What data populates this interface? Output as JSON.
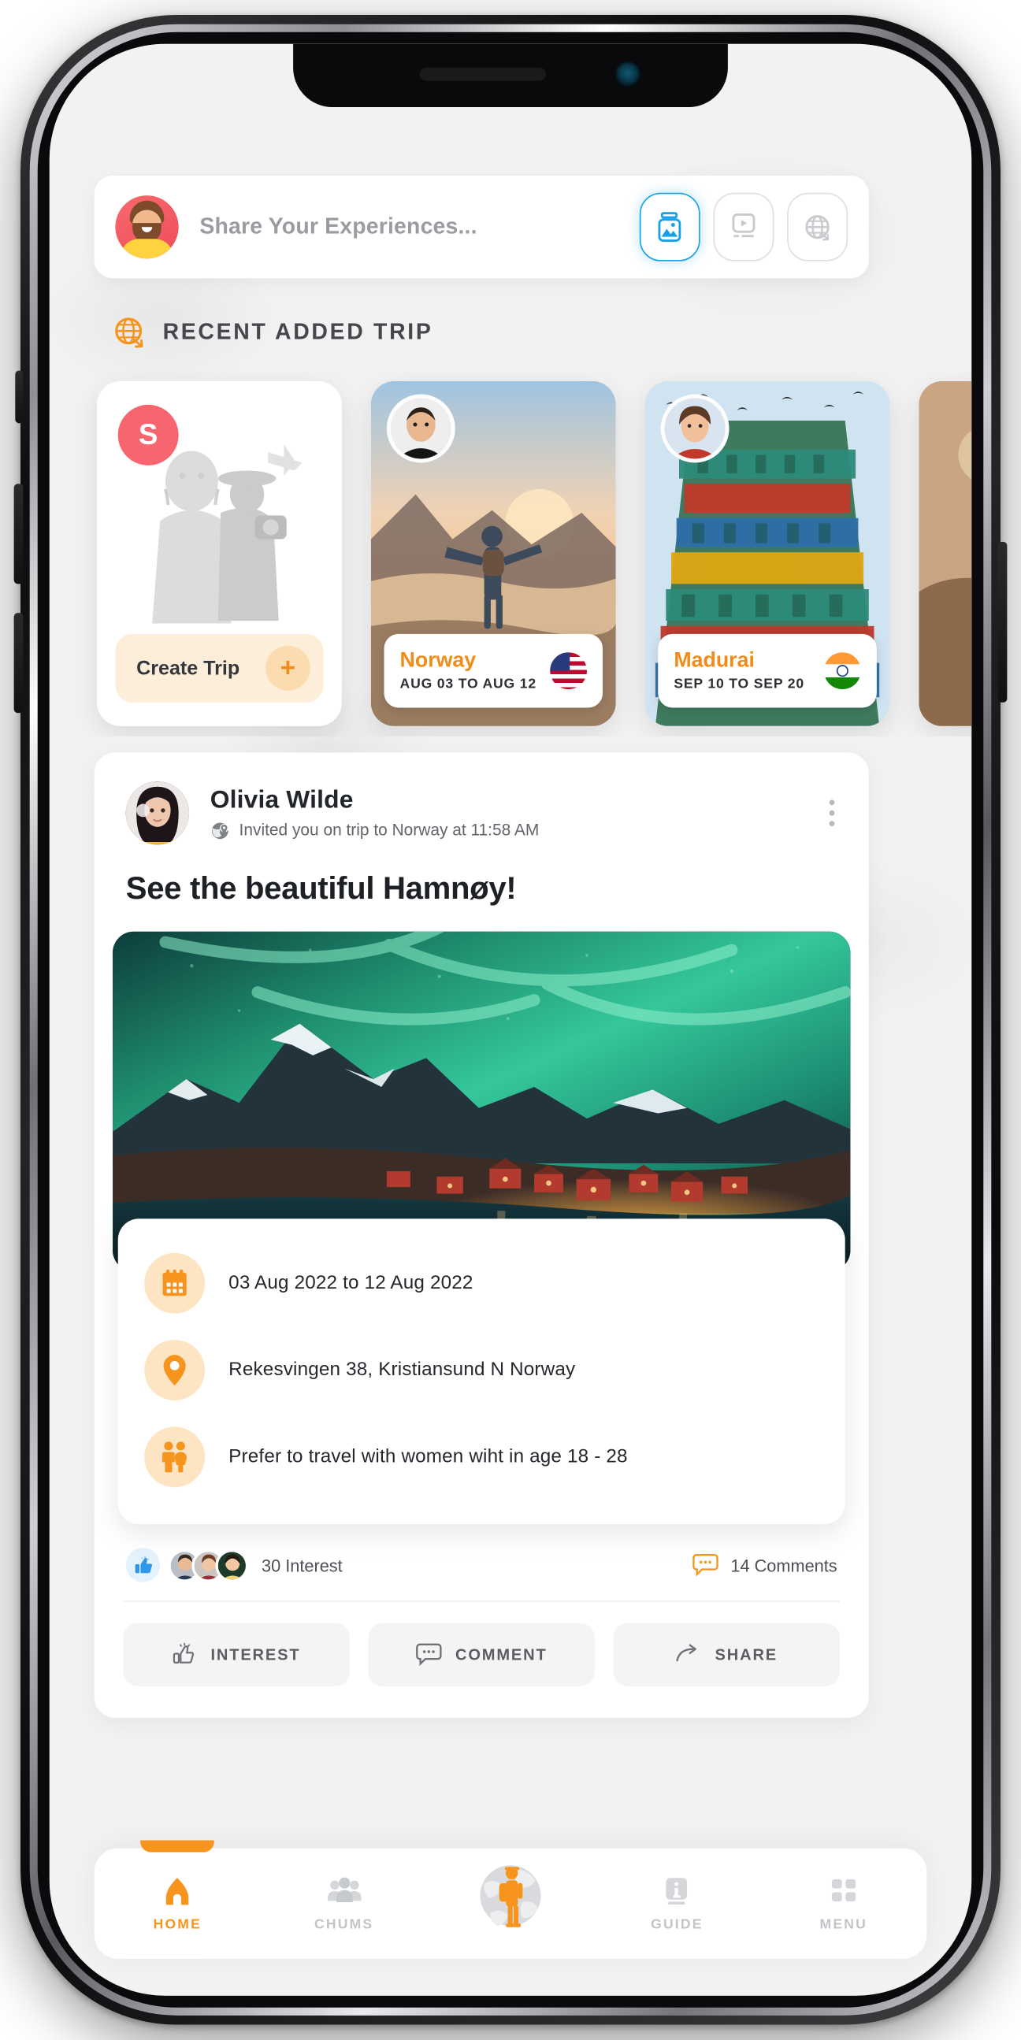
{
  "app": {
    "share": {
      "placeholder": "Share Your Experiences...",
      "avatar_name": "user-avatar",
      "actions": [
        {
          "name": "photo",
          "icon": "image-icon",
          "active": true
        },
        {
          "name": "video",
          "icon": "video-icon",
          "active": false
        },
        {
          "name": "globe",
          "icon": "globe-icon",
          "active": false
        }
      ]
    },
    "section": {
      "title": "RECENT ADDED TRIP",
      "icon": "globe-plane-icon"
    },
    "trips": [
      {
        "type": "create",
        "badge": "S",
        "label": "Create Trip",
        "plus": "+"
      },
      {
        "type": "trip",
        "name": "Norway",
        "dates": "AUG 03 TO AUG 12",
        "flag": "us"
      },
      {
        "type": "trip",
        "name": "Madurai",
        "dates": "SEP 10 TO SEP 20",
        "flag": "in"
      }
    ],
    "post": {
      "author": "Olivia Wilde",
      "subtitle": "Invited you on trip to Norway at 11:58 AM",
      "subtitle_icon": "globe-pin-icon",
      "menu_icon": "more-vertical-icon",
      "title": "See the beautiful Hamnøy!",
      "details": [
        {
          "icon": "calendar-icon",
          "text": "03 Aug 2022  to 12 Aug 2022"
        },
        {
          "icon": "location-pin-icon",
          "text": "Rekesvingen 38, Kristiansund N Norway"
        },
        {
          "icon": "people-icon",
          "text": "Prefer to travel with women wiht in age 18 - 28"
        }
      ],
      "interest_count": "30 Interest",
      "comment_count": "14 Comments",
      "actions": [
        {
          "label": "INTEREST",
          "icon": "thumbs-up-icon"
        },
        {
          "label": "COMMENT",
          "icon": "comment-icon"
        },
        {
          "label": "SHARE",
          "icon": "share-icon"
        }
      ]
    },
    "nav": [
      {
        "label": "HOME",
        "icon": "home-icon",
        "active": true
      },
      {
        "label": "CHUMS",
        "icon": "people-icon",
        "active": false
      },
      {
        "label": "",
        "icon": "traveler-globe-icon",
        "active": false,
        "center": true
      },
      {
        "label": "GUIDE",
        "icon": "info-book-icon",
        "active": false
      },
      {
        "label": "MENU",
        "icon": "grid-icon",
        "active": false
      }
    ],
    "colors": {
      "accent": "#f7941d",
      "accent_light": "#fde4c3",
      "blue": "#17a2e8",
      "pink": "#f7656f",
      "text_dark": "#22252a",
      "text_muted": "#62656b"
    }
  }
}
